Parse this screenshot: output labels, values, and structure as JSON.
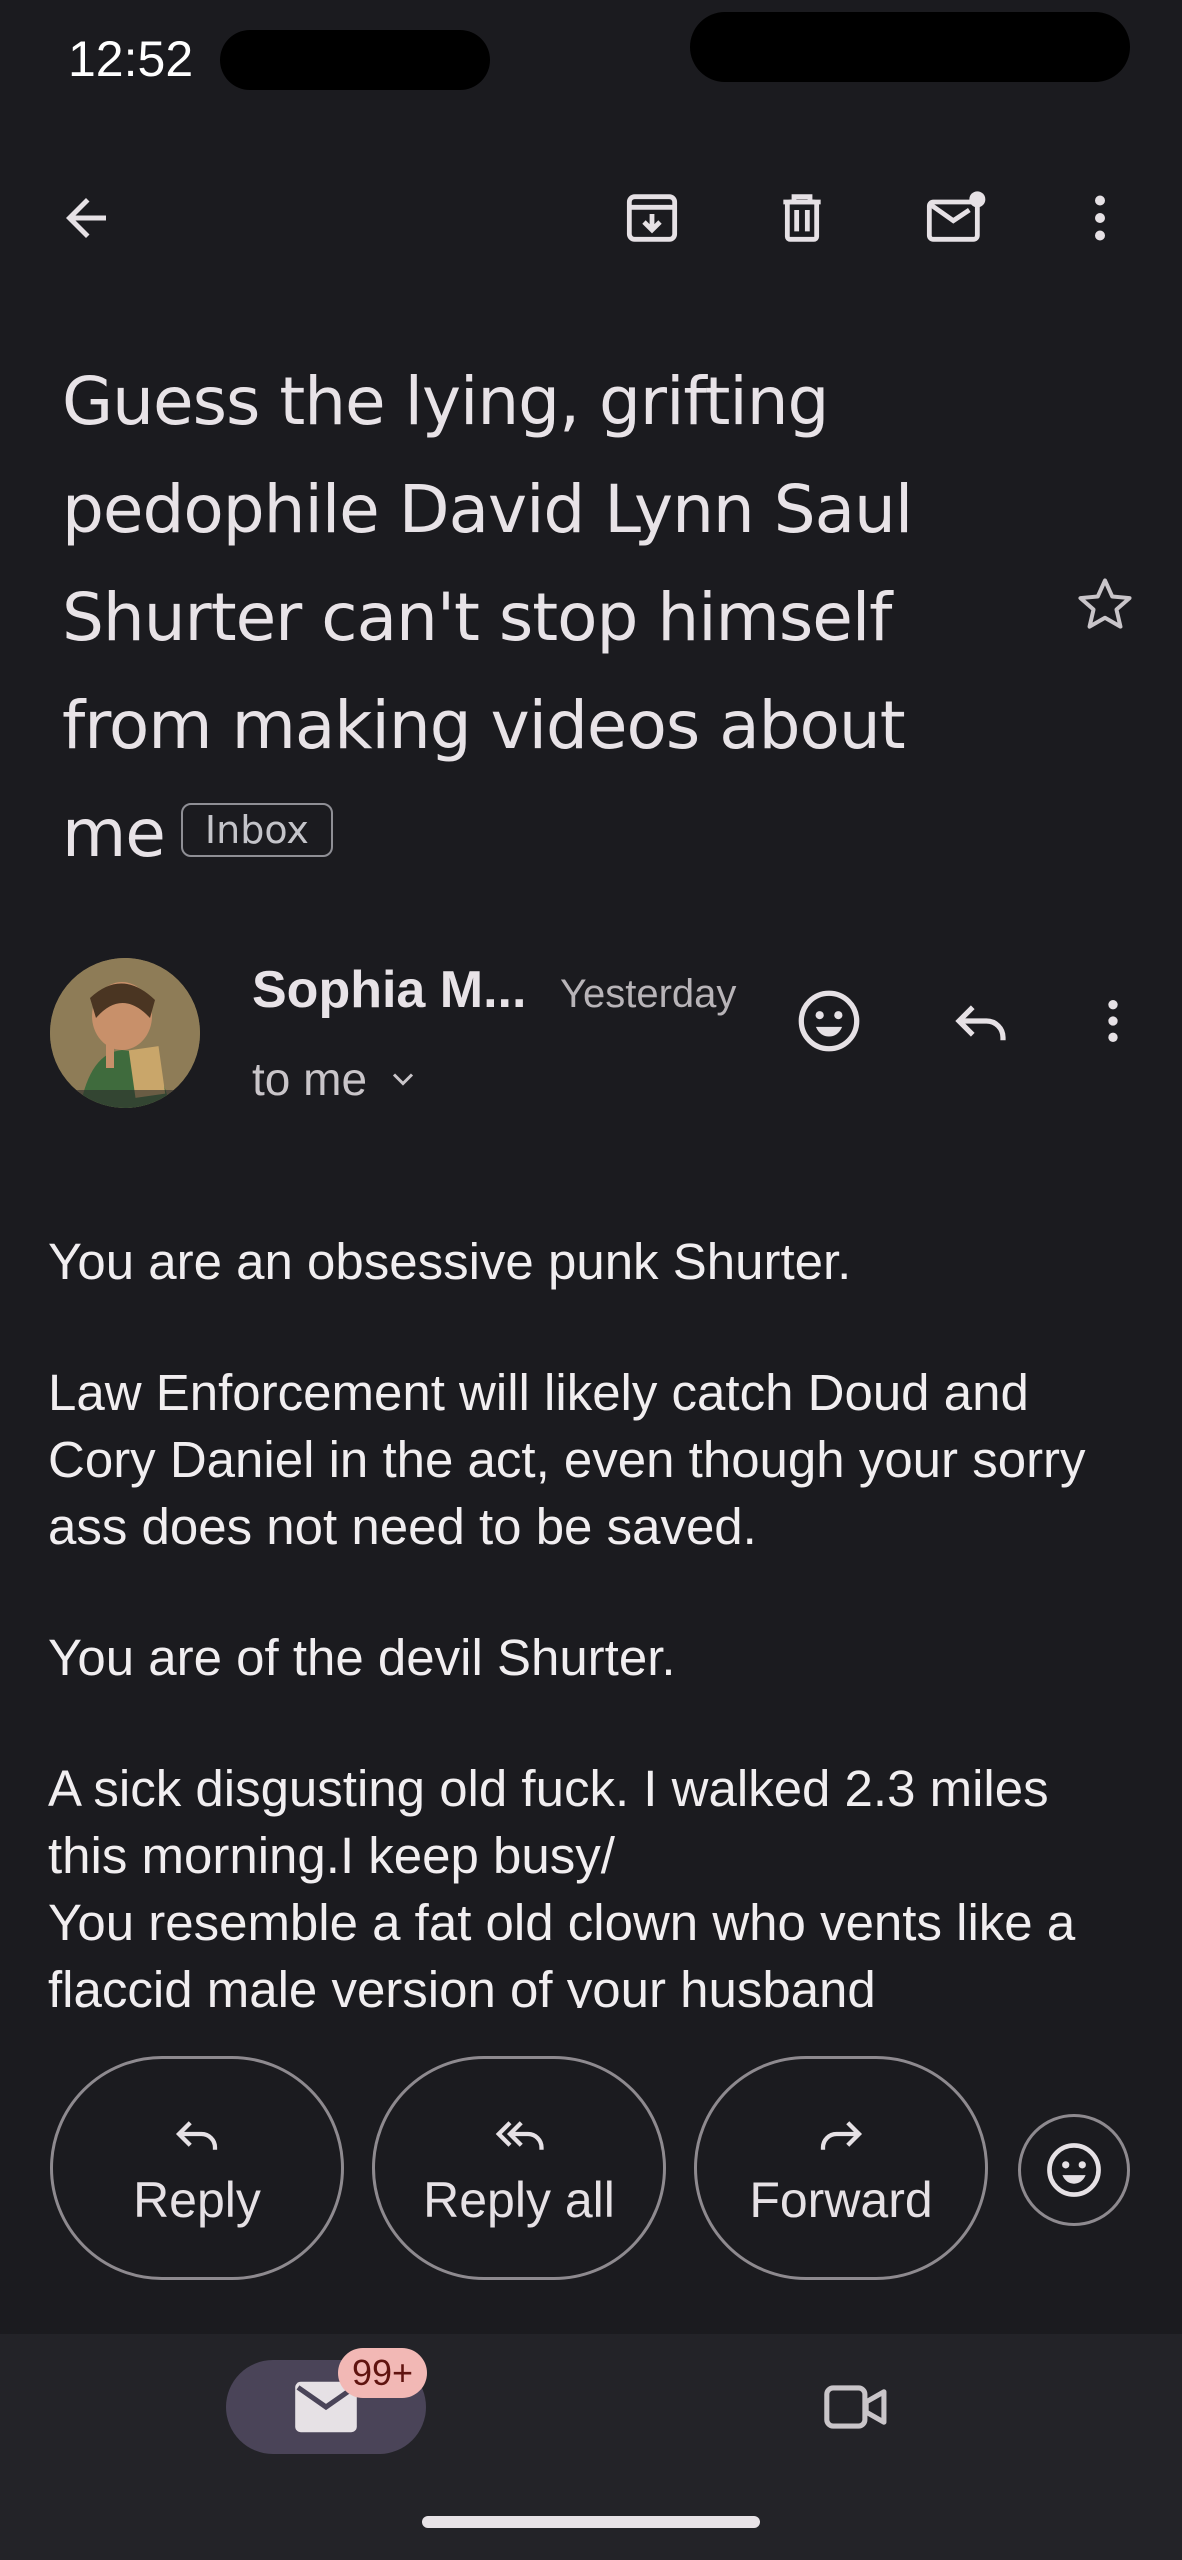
{
  "status_bar": {
    "time": "12:52"
  },
  "toolbar": {
    "back": "back-icon",
    "archive": "archive-icon",
    "delete": "delete-icon",
    "mark_unread": "mark-unread-icon",
    "more": "more-vert-icon"
  },
  "email": {
    "subject": "Guess the lying, grifting pedophile David Lynn Saul Shurter can't stop himself from making videos about me",
    "label_chip": "Inbox",
    "sender": "Sophia M...",
    "date": "Yesterday",
    "recipient": "to me",
    "body": [
      "You are an obsessive punk Shurter.",
      "Law Enforcement will likely catch Doud and Cory Daniel in the act, even though your sorry ass does not need to be saved.",
      "You are of the devil Shurter.",
      "A sick disgusting old fuck. I walked 2.3 miles this morning.I keep busy/",
      "You resemble a fat old clown who vents like a flaccid male version of your husband"
    ]
  },
  "actions": {
    "reply": "Reply",
    "reply_all": "Reply all",
    "forward": "Forward"
  },
  "bottom_nav": {
    "mail_badge": "99+"
  },
  "colors": {
    "background": "#1b1b1f",
    "nav_background": "#232328",
    "pill": "#4a4458",
    "badge": "#f2b8b5"
  }
}
